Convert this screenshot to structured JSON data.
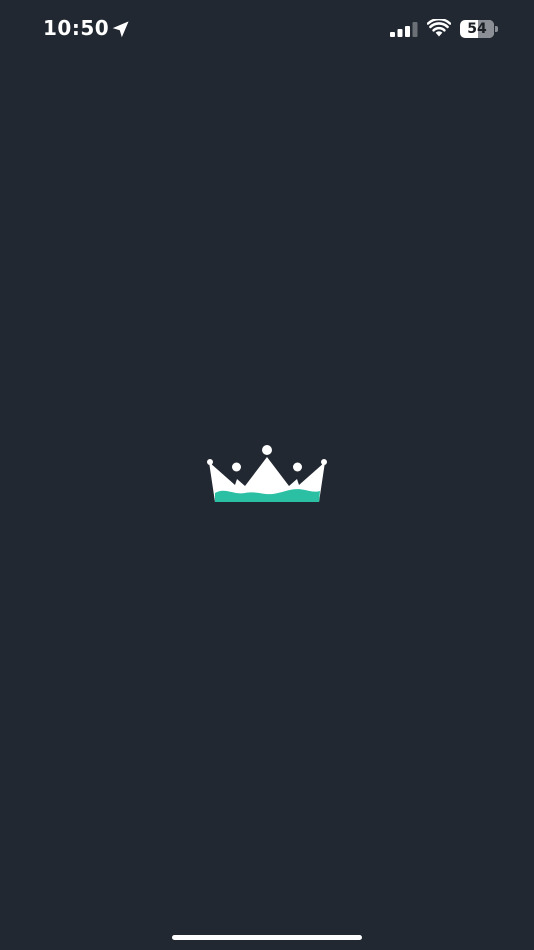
{
  "status_bar": {
    "time": "10:50",
    "battery_level": "54",
    "battery_fraction": 0.54,
    "signal_bars_active": 3,
    "signal_bars_total": 4,
    "icons": [
      "location-arrow-icon",
      "cellular-signal-icon",
      "wifi-icon",
      "battery-icon"
    ]
  },
  "splash": {
    "logo_icon": "crown-logo",
    "background_color": "#222831",
    "logo_primary_color": "#ffffff",
    "logo_accent_color": "#2bbfa4"
  },
  "home_indicator": {
    "color": "#ffffff"
  }
}
